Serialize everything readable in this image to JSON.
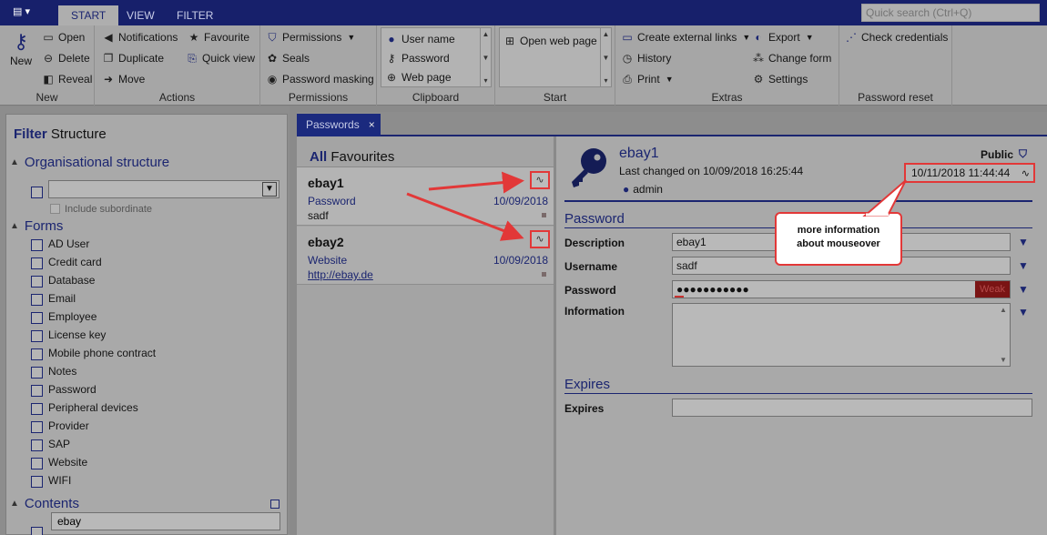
{
  "menubar": {
    "tabs": [
      "START",
      "VIEW",
      "FILTER"
    ],
    "active_tab": "START",
    "quick_search_placeholder": "Quick search (Ctrl+Q)"
  },
  "ribbon": {
    "new": {
      "label": "New",
      "buttons": [
        "Open",
        "Delete",
        "Reveal"
      ],
      "group": "New"
    },
    "actions": {
      "buttons": [
        "Notifications",
        "Favourite",
        "Duplicate",
        "Quick view",
        "Move"
      ],
      "group": "Actions"
    },
    "permissions": {
      "buttons": [
        "Permissions",
        "Seals",
        "Password masking"
      ],
      "group": "Permissions"
    },
    "clipboard": {
      "items": [
        "User name",
        "Password",
        "Web page"
      ],
      "group": "Clipboard"
    },
    "start": {
      "items": [
        "Open web page"
      ],
      "group": "Start"
    },
    "extras": {
      "buttons": [
        "Create external links",
        "Export",
        "History",
        "Change form",
        "Print",
        "Settings"
      ],
      "group": "Extras"
    },
    "password_reset": {
      "buttons": [
        "Check credentials"
      ],
      "group": "Password reset"
    }
  },
  "filter": {
    "title_bold": "Filter",
    "title_rest": "Structure",
    "org_structure": "Organisational structure",
    "include_subordinate": "Include subordinate",
    "forms_header": "Forms",
    "forms": [
      "AD User",
      "Credit card",
      "Database",
      "Email",
      "Employee",
      "License key",
      "Mobile phone contract",
      "Notes",
      "Password",
      "Peripheral devices",
      "Provider",
      "SAP",
      "Website",
      "WIFI"
    ],
    "contents_header": "Contents",
    "contents_value": "ebay"
  },
  "tab": {
    "label": "Passwords",
    "close": "×"
  },
  "list": {
    "header_bold": "All",
    "header_rest": "Favourites",
    "items": [
      {
        "name": "ebay1",
        "type": "Password",
        "date": "10/09/2018",
        "sub": "sadf"
      },
      {
        "name": "ebay2",
        "type": "Website",
        "date": "10/09/2018",
        "sub": "http://ebay.de"
      }
    ]
  },
  "detail": {
    "title": "ebay1",
    "last_changed": "Last changed on 10/09/2018 16:25:44",
    "user": "admin",
    "visibility": "Public",
    "timestamp": "10/11/2018 11:44:44",
    "password_section": "Password",
    "fields": {
      "description_label": "Description",
      "description_value": "ebay1",
      "username_label": "Username",
      "username_value": "sadf",
      "password_label": "Password",
      "password_value": "●●●●●●●●●●●",
      "strength": "Weak",
      "information_label": "Information"
    },
    "expires_section": "Expires",
    "expires_label": "Expires"
  },
  "callout": {
    "line1": "more information",
    "line2": "about mouseover"
  },
  "colors": {
    "accent": "#1b2570",
    "highlight": "#e23838"
  }
}
